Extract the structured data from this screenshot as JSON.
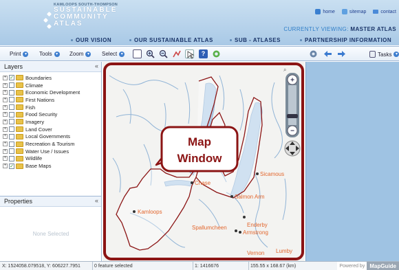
{
  "header": {
    "logo_tag": "KAMLOOPS SOUTH-THOMPSON",
    "logo_lines": [
      "SUSTAINABLE",
      "COMMUNITY",
      "ATLAS"
    ],
    "links": {
      "home": "home",
      "sitemap": "sitemap",
      "contact": "contact"
    },
    "viewing_label": "CURRENTLY VIEWING:",
    "viewing_value": "MASTER ATLAS",
    "nav": [
      "OUR VISION",
      "OUR SUSTAINABLE ATLAS",
      "SUB - ATLASES",
      "PARTNERSHIP INFORMATION"
    ]
  },
  "toolbar": {
    "print": "Print",
    "tools": "Tools",
    "zoom": "Zoom",
    "select": "Select",
    "tasks": "Tasks"
  },
  "layers": {
    "title": "Layers",
    "items": [
      {
        "label": "Boundaries",
        "checked": true
      },
      {
        "label": "Climate",
        "checked": false
      },
      {
        "label": "Economic Development",
        "checked": false
      },
      {
        "label": "First Nations",
        "checked": false
      },
      {
        "label": "Fish",
        "checked": false
      },
      {
        "label": "Food Security",
        "checked": false
      },
      {
        "label": "Imagery",
        "checked": false
      },
      {
        "label": "Land Cover",
        "checked": false
      },
      {
        "label": "Local Governments",
        "checked": false
      },
      {
        "label": "Recreation & Tourism",
        "checked": false
      },
      {
        "label": "Water Use / Issues",
        "checked": false
      },
      {
        "label": "Wildlife",
        "checked": false
      },
      {
        "label": "Base Maps",
        "checked": true
      }
    ]
  },
  "properties": {
    "title": "Properties",
    "empty": "None Selected"
  },
  "map": {
    "callout_lines": [
      "Map",
      "Window"
    ],
    "places": [
      "Kamloops",
      "Chase",
      "Sicamous",
      "Salmon Arm",
      "Enderby",
      "Spallumcheen",
      "Armstrong",
      "Vernon",
      "Lumby"
    ]
  },
  "status": {
    "coords": "X: 1524058.079518, Y: 606227.7951",
    "selected": "0 feature selected",
    "scale": "1: 1416676",
    "size": "155.55 x 168.67 (km)",
    "powered": "Powered by",
    "brand": "MapGuide"
  },
  "colors": {
    "accent": "#8b1414",
    "place_label": "#e2662d",
    "header": "#b5d2eb"
  }
}
